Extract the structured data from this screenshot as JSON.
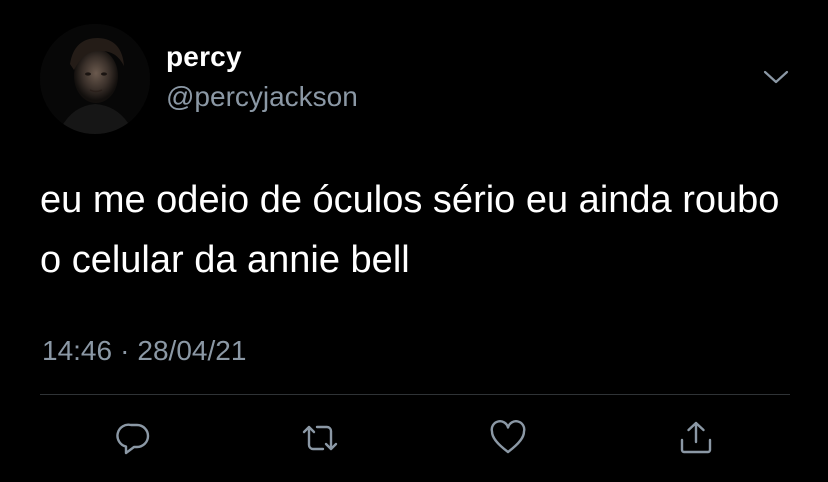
{
  "tweet": {
    "display_name": "percy",
    "handle": "@percyjackson",
    "text": "eu me odeio de óculos sério eu ainda roubo o celular da annie bell",
    "time": "14:46",
    "separator": "·",
    "date": "28/04/21"
  },
  "icons": {
    "more": "chevron-down-icon",
    "reply": "reply-icon",
    "retweet": "retweet-icon",
    "like": "heart-icon",
    "share": "share-icon"
  },
  "colors": {
    "background": "#000000",
    "primary_text": "#ffffff",
    "secondary_text": "#8b98a5",
    "icon": "#8b98a5",
    "divider": "#2f3336"
  }
}
